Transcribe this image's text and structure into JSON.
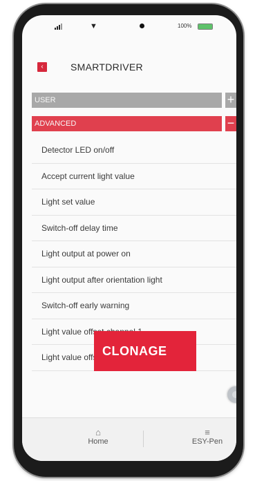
{
  "status_bar": {
    "battery_text": "100%",
    "battery_level": 1.0
  },
  "header": {
    "title": "SMARTDRIVER"
  },
  "sections": {
    "user": {
      "label": "USER",
      "toggle": "+"
    },
    "advanced": {
      "label": "ADVANCED",
      "toggle": "−"
    }
  },
  "menu": {
    "items": [
      "Detector LED on/off",
      "Accept current light value",
      "Light set value",
      "Switch-off delay time",
      "Light output at power on",
      "Light output after orientation light",
      "Switch-off early warning",
      "Light value offset channel 1",
      "Light value offset channel 2"
    ]
  },
  "tabs": {
    "home": {
      "label": "Home",
      "icon": "home-icon"
    },
    "esy_pen": {
      "label": "ESY-Pen",
      "icon": "sliders-icon"
    }
  },
  "watermark": {
    "text": "CLONAGE"
  },
  "colors": {
    "accent": "#e0404e",
    "user_bar": "#a8a8a8",
    "watermark": "#e3243a"
  }
}
